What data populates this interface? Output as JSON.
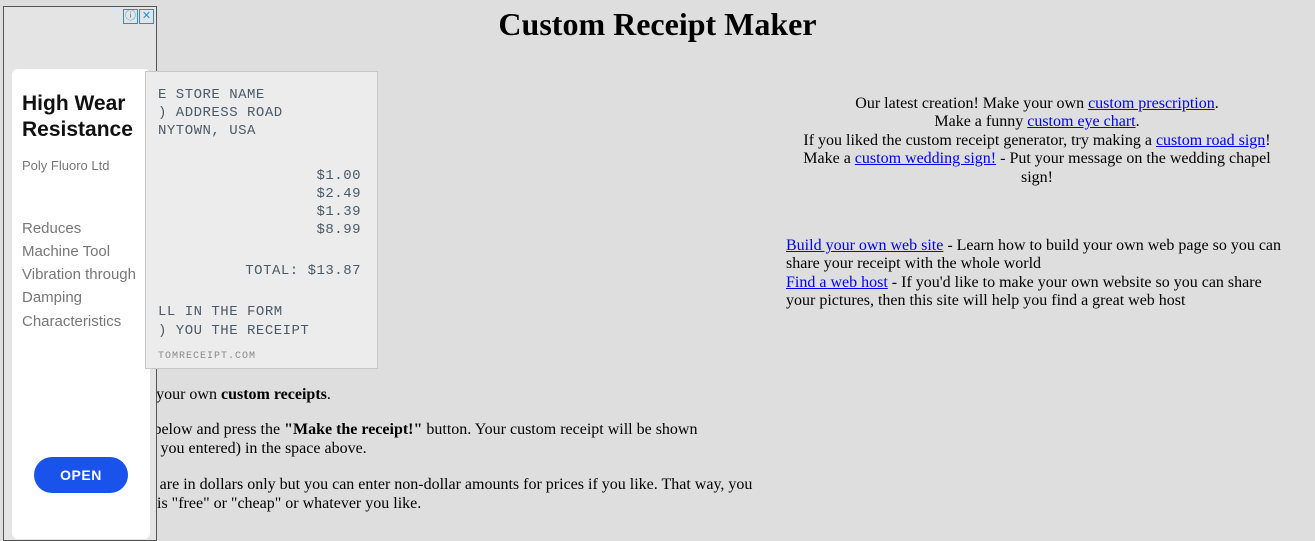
{
  "ad": {
    "title": "High Wear Resistance",
    "brand": "Poly Fluoro Ltd",
    "desc": "Reduces Machine Tool Vibration through Damping Characteristics",
    "button": "OPEN"
  },
  "page": {
    "title": "Custom Receipt Maker"
  },
  "receipt": {
    "line1": "E STORE NAME",
    "line2": ") ADDRESS ROAD",
    "line3": "NYTOWN, USA",
    "price1": "$1.00",
    "price2": "$2.49",
    "price3": "$1.39",
    "price4": "$8.99",
    "total": "TOTAL: $13.87",
    "instr1": "LL IN THE FORM",
    "instr2": ") YOU THE RECEIPT",
    "footer": "TOMRECEIPT.COM"
  },
  "left": {
    "p1a": "e your own ",
    "p1b": "custom receipts",
    "p1c": ".",
    "p2a": "t below and press the ",
    "p2b": "\"Make the receipt!\"",
    "p2c": " button. Your custom receipt will be shown",
    "p2d": "at you entered) in the space above.",
    "p3a": "ts are in dollars only but you can enter non-dollar amounts for prices if you like. That way, you",
    "p3b": "g is \"free\" or \"cheap\" or whatever you like."
  },
  "right": {
    "c1a": "Our latest creation! Make your own ",
    "c1link": "custom prescription",
    "c1b": ".",
    "c2a": "Make a funny ",
    "c2link": "custom eye chart",
    "c2b": ".",
    "c3a": "If you liked the custom receipt generator, try making a ",
    "c3link": "custom road sign",
    "c3b": "!",
    "c4a": "Make a ",
    "c4link": "custom wedding sign!",
    "c4b": " - Put your message on the wedding chapel sign!",
    "b1link": "Build your own web site",
    "b1text": " - Learn how to build your own web page so you can share your receipt with the whole world",
    "b2link": "Find a web host",
    "b2text": " - If you'd like to make your own website so you can share your pictures, then this site will help you find a great web host"
  }
}
